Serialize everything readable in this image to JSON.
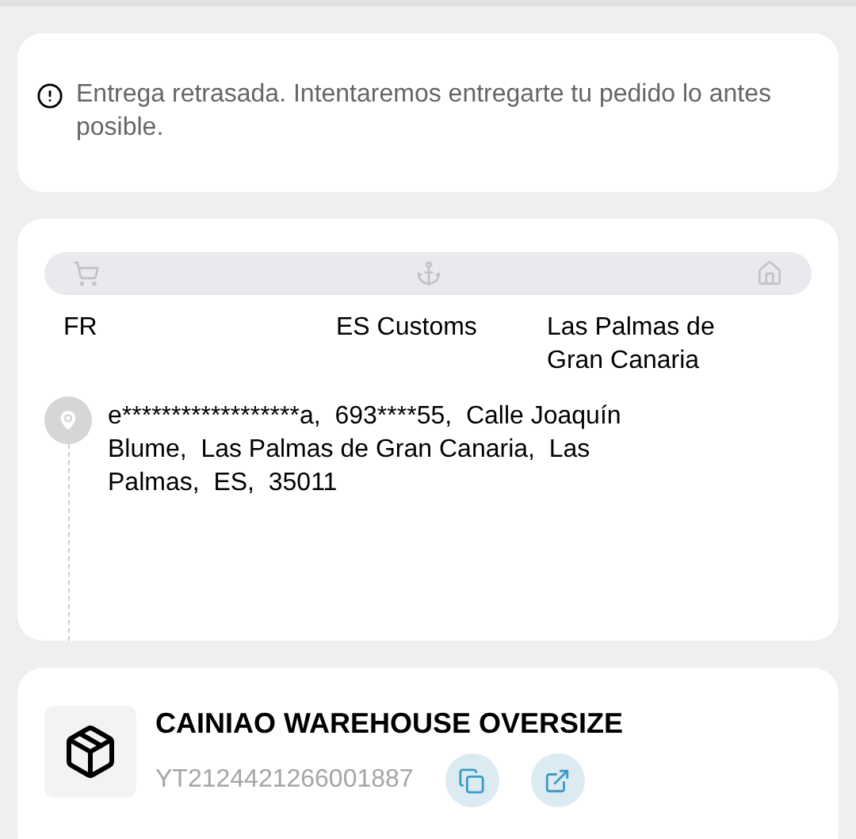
{
  "notice": {
    "text": "Entrega retrasada. Intentaremos entregarte tu pedido lo antes posible."
  },
  "route": {
    "stages": [
      {
        "kind": "cart",
        "label": "FR"
      },
      {
        "kind": "port",
        "label": "ES Customs"
      },
      {
        "kind": "home",
        "label": "Las Palmas de Gran Canaria"
      }
    ]
  },
  "address": {
    "text": "e******************a,  693****55,  Calle Joaquín Blume,  Las Palmas de Gran Canaria,  Las Palmas,  ES,  35011"
  },
  "carrier": {
    "name": "CAINIAO WAREHOUSE OVERSIZE",
    "tracking_number": "YT2124421266001887"
  }
}
